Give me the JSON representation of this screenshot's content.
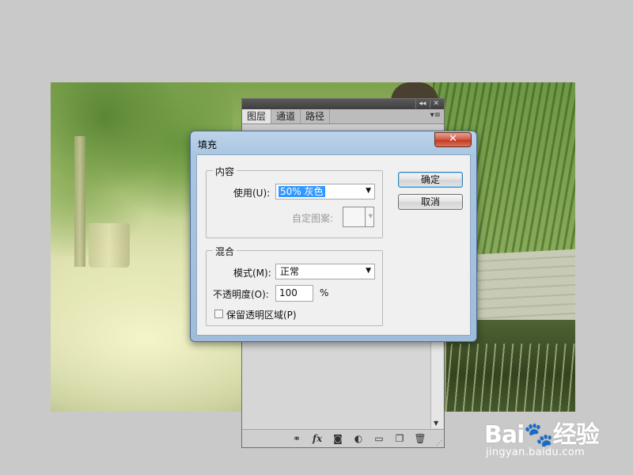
{
  "layers_panel": {
    "tabs": [
      {
        "label": "图层"
      },
      {
        "label": "通道"
      },
      {
        "label": "路径"
      }
    ],
    "collapse_glyph": "◂◂",
    "close_glyph": "✕",
    "menu_glyph": "▾≡",
    "footer_icons": [
      "link-icon",
      "fx-icon",
      "mask-icon",
      "adjustment-icon",
      "folder-icon",
      "new-layer-icon",
      "trash-icon"
    ],
    "fx_label": "fx"
  },
  "fill_dialog": {
    "title": "填充",
    "close_glyph": "✕",
    "content_group": {
      "legend": "内容",
      "use_label": "使用(U):",
      "use_value": "50% 灰色",
      "custom_pattern_label": "自定图案:"
    },
    "blend_group": {
      "legend": "混合",
      "mode_label": "模式(M):",
      "mode_value": "正常",
      "opacity_label": "不透明度(O):",
      "opacity_value": "100",
      "opacity_unit": "%",
      "preserve_label": "保留透明区域(P)",
      "preserve_checked": false
    },
    "ok_label": "确定",
    "cancel_label": "取消"
  },
  "watermark": {
    "logo_text": "Bai🐾经验",
    "url_text": "jingyan.baidu.com"
  }
}
